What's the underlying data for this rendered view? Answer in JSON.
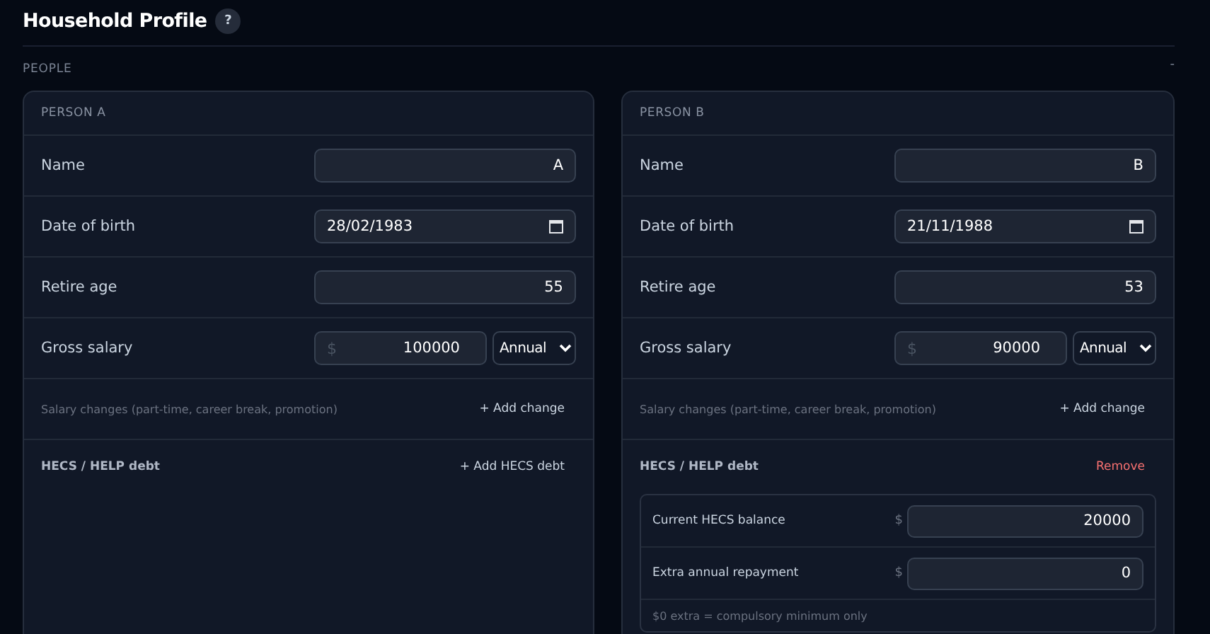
{
  "title": "Household Profile",
  "help": "?",
  "section": {
    "label": "PEOPLE",
    "toggle": "-"
  },
  "people": [
    {
      "header": "PERSON A",
      "name_label": "Name",
      "name": "A",
      "dob_label": "Date of birth",
      "dob": "28/02/1983",
      "retire_label": "Retire age",
      "retire": "55",
      "salary_label": "Gross salary",
      "currency": "$",
      "salary": "100000",
      "period": "Annual",
      "changes_label": "Salary changes (part-time, career break, promotion)",
      "changes_action": "+ Add change",
      "hecs": {
        "kind": "empty",
        "label": "HECS / HELP debt",
        "action": "+ Add HECS debt"
      }
    },
    {
      "header": "PERSON B",
      "name_label": "Name",
      "name": "B",
      "dob_label": "Date of birth",
      "dob": "21/11/1988",
      "retire_label": "Retire age",
      "retire": "53",
      "salary_label": "Gross salary",
      "currency": "$",
      "salary": "90000",
      "period": "Annual",
      "changes_label": "Salary changes (part-time, career break, promotion)",
      "changes_action": "+ Add change",
      "hecs": {
        "kind": "active",
        "label": "HECS / HELP debt",
        "action": "Remove",
        "fields": [
          {
            "label": "Current HECS balance",
            "currency": "$",
            "value": "20000"
          },
          {
            "label": "Extra annual repayment",
            "currency": "$",
            "value": "0"
          }
        ],
        "note": "$0 extra = compulsory minimum only"
      }
    }
  ]
}
